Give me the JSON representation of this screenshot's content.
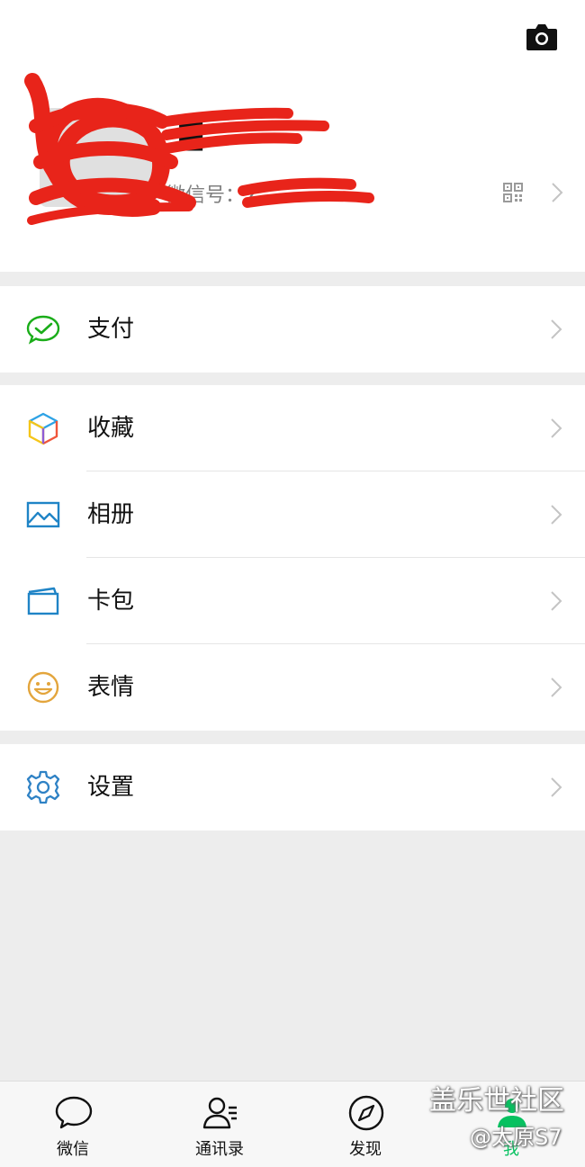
{
  "profile": {
    "nickname": "▐▌",
    "wechat_id_label": "微信号：",
    "wechat_id_value": "∠"
  },
  "menu": {
    "pay": "支付",
    "favorites": "收藏",
    "album": "相册",
    "cards": "卡包",
    "stickers": "表情",
    "settings": "设置"
  },
  "tabbar": {
    "chats": "微信",
    "contacts": "通讯录",
    "discover": "发现",
    "me": "我"
  },
  "watermark": {
    "line1": "盖乐世社区",
    "line2": "@太原S7"
  },
  "colors": {
    "accent": "#07c160",
    "background": "#ededed",
    "scribble": "#e8241a"
  }
}
